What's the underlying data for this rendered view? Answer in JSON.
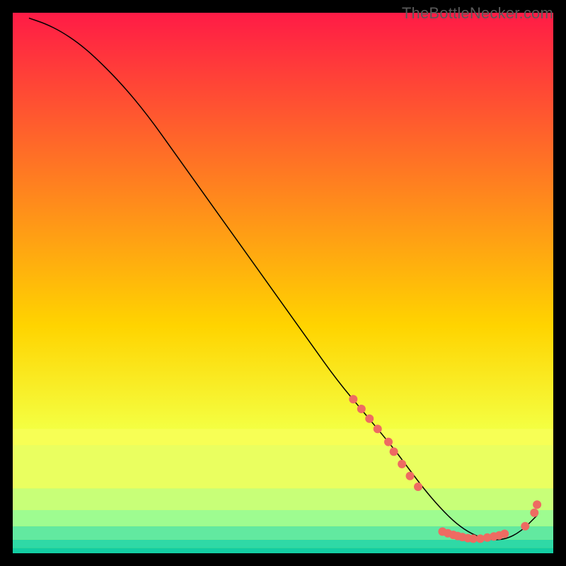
{
  "branding": {
    "watermark": "TheBottleNecker.com"
  },
  "chart_data": {
    "type": "line",
    "title": "",
    "xlabel": "",
    "ylabel": "",
    "xlim": [
      0,
      100
    ],
    "ylim": [
      0,
      100
    ],
    "series": [
      {
        "name": "bottleneck-curve",
        "x": [
          3,
          6,
          9,
          12,
          15,
          20,
          25,
          30,
          35,
          40,
          45,
          50,
          55,
          60,
          65,
          70,
          73,
          76,
          79,
          82,
          85,
          88,
          91,
          94,
          97
        ],
        "y": [
          99,
          98,
          96.5,
          94.5,
          92,
          87,
          81,
          74,
          67,
          60,
          53,
          46,
          39,
          32,
          26,
          20,
          16,
          12,
          8.5,
          5.5,
          3.5,
          2.5,
          2.5,
          4,
          7
        ],
        "color": "#000000",
        "line_width": 1.5
      }
    ],
    "markers": [
      {
        "name": "marker-1",
        "x": 63.0,
        "y": 28.5
      },
      {
        "name": "marker-2",
        "x": 64.5,
        "y": 26.7
      },
      {
        "name": "marker-3",
        "x": 66.0,
        "y": 24.9
      },
      {
        "name": "marker-4",
        "x": 67.5,
        "y": 23.0
      },
      {
        "name": "marker-5",
        "x": 69.5,
        "y": 20.6
      },
      {
        "name": "marker-6",
        "x": 70.5,
        "y": 18.8
      },
      {
        "name": "marker-7",
        "x": 72.0,
        "y": 16.5
      },
      {
        "name": "marker-8",
        "x": 73.5,
        "y": 14.3
      },
      {
        "name": "marker-9",
        "x": 75.0,
        "y": 12.3
      },
      {
        "name": "marker-10",
        "x": 79.5,
        "y": 4.0
      },
      {
        "name": "marker-11",
        "x": 80.5,
        "y": 3.7
      },
      {
        "name": "marker-12",
        "x": 81.5,
        "y": 3.4
      },
      {
        "name": "marker-13",
        "x": 82.3,
        "y": 3.2
      },
      {
        "name": "marker-14",
        "x": 83.2,
        "y": 3.0
      },
      {
        "name": "marker-15",
        "x": 84.2,
        "y": 2.8
      },
      {
        "name": "marker-16",
        "x": 85.2,
        "y": 2.7
      },
      {
        "name": "marker-17",
        "x": 86.5,
        "y": 2.7
      },
      {
        "name": "marker-18",
        "x": 87.8,
        "y": 2.9
      },
      {
        "name": "marker-19",
        "x": 89.0,
        "y": 3.1
      },
      {
        "name": "marker-20",
        "x": 90.0,
        "y": 3.3
      },
      {
        "name": "marker-21",
        "x": 91.0,
        "y": 3.6
      },
      {
        "name": "marker-22",
        "x": 94.8,
        "y": 5.0
      },
      {
        "name": "marker-23",
        "x": 96.5,
        "y": 7.5
      },
      {
        "name": "marker-24",
        "x": 97.0,
        "y": 9.0
      }
    ],
    "marker_style": {
      "fill": "#ee6b62",
      "radius": 6
    },
    "background": {
      "type": "vertical-gradient-with-bottom-bands",
      "gradient_start": "#ff1b46",
      "gradient_mid": "#ffd400",
      "gradient_end": "#f4ff42",
      "bottom_bands": [
        {
          "color": "#f7ff55",
          "from_pct": 77,
          "to_pct": 80
        },
        {
          "color": "#eaff60",
          "from_pct": 80,
          "to_pct": 88
        },
        {
          "color": "#c8ff78",
          "from_pct": 88,
          "to_pct": 92
        },
        {
          "color": "#9efc90",
          "from_pct": 92,
          "to_pct": 95
        },
        {
          "color": "#62e9a0",
          "from_pct": 95,
          "to_pct": 97.5
        },
        {
          "color": "#2fd9a6",
          "from_pct": 97.5,
          "to_pct": 99
        },
        {
          "color": "#13cda2",
          "from_pct": 99,
          "to_pct": 100
        }
      ]
    }
  }
}
